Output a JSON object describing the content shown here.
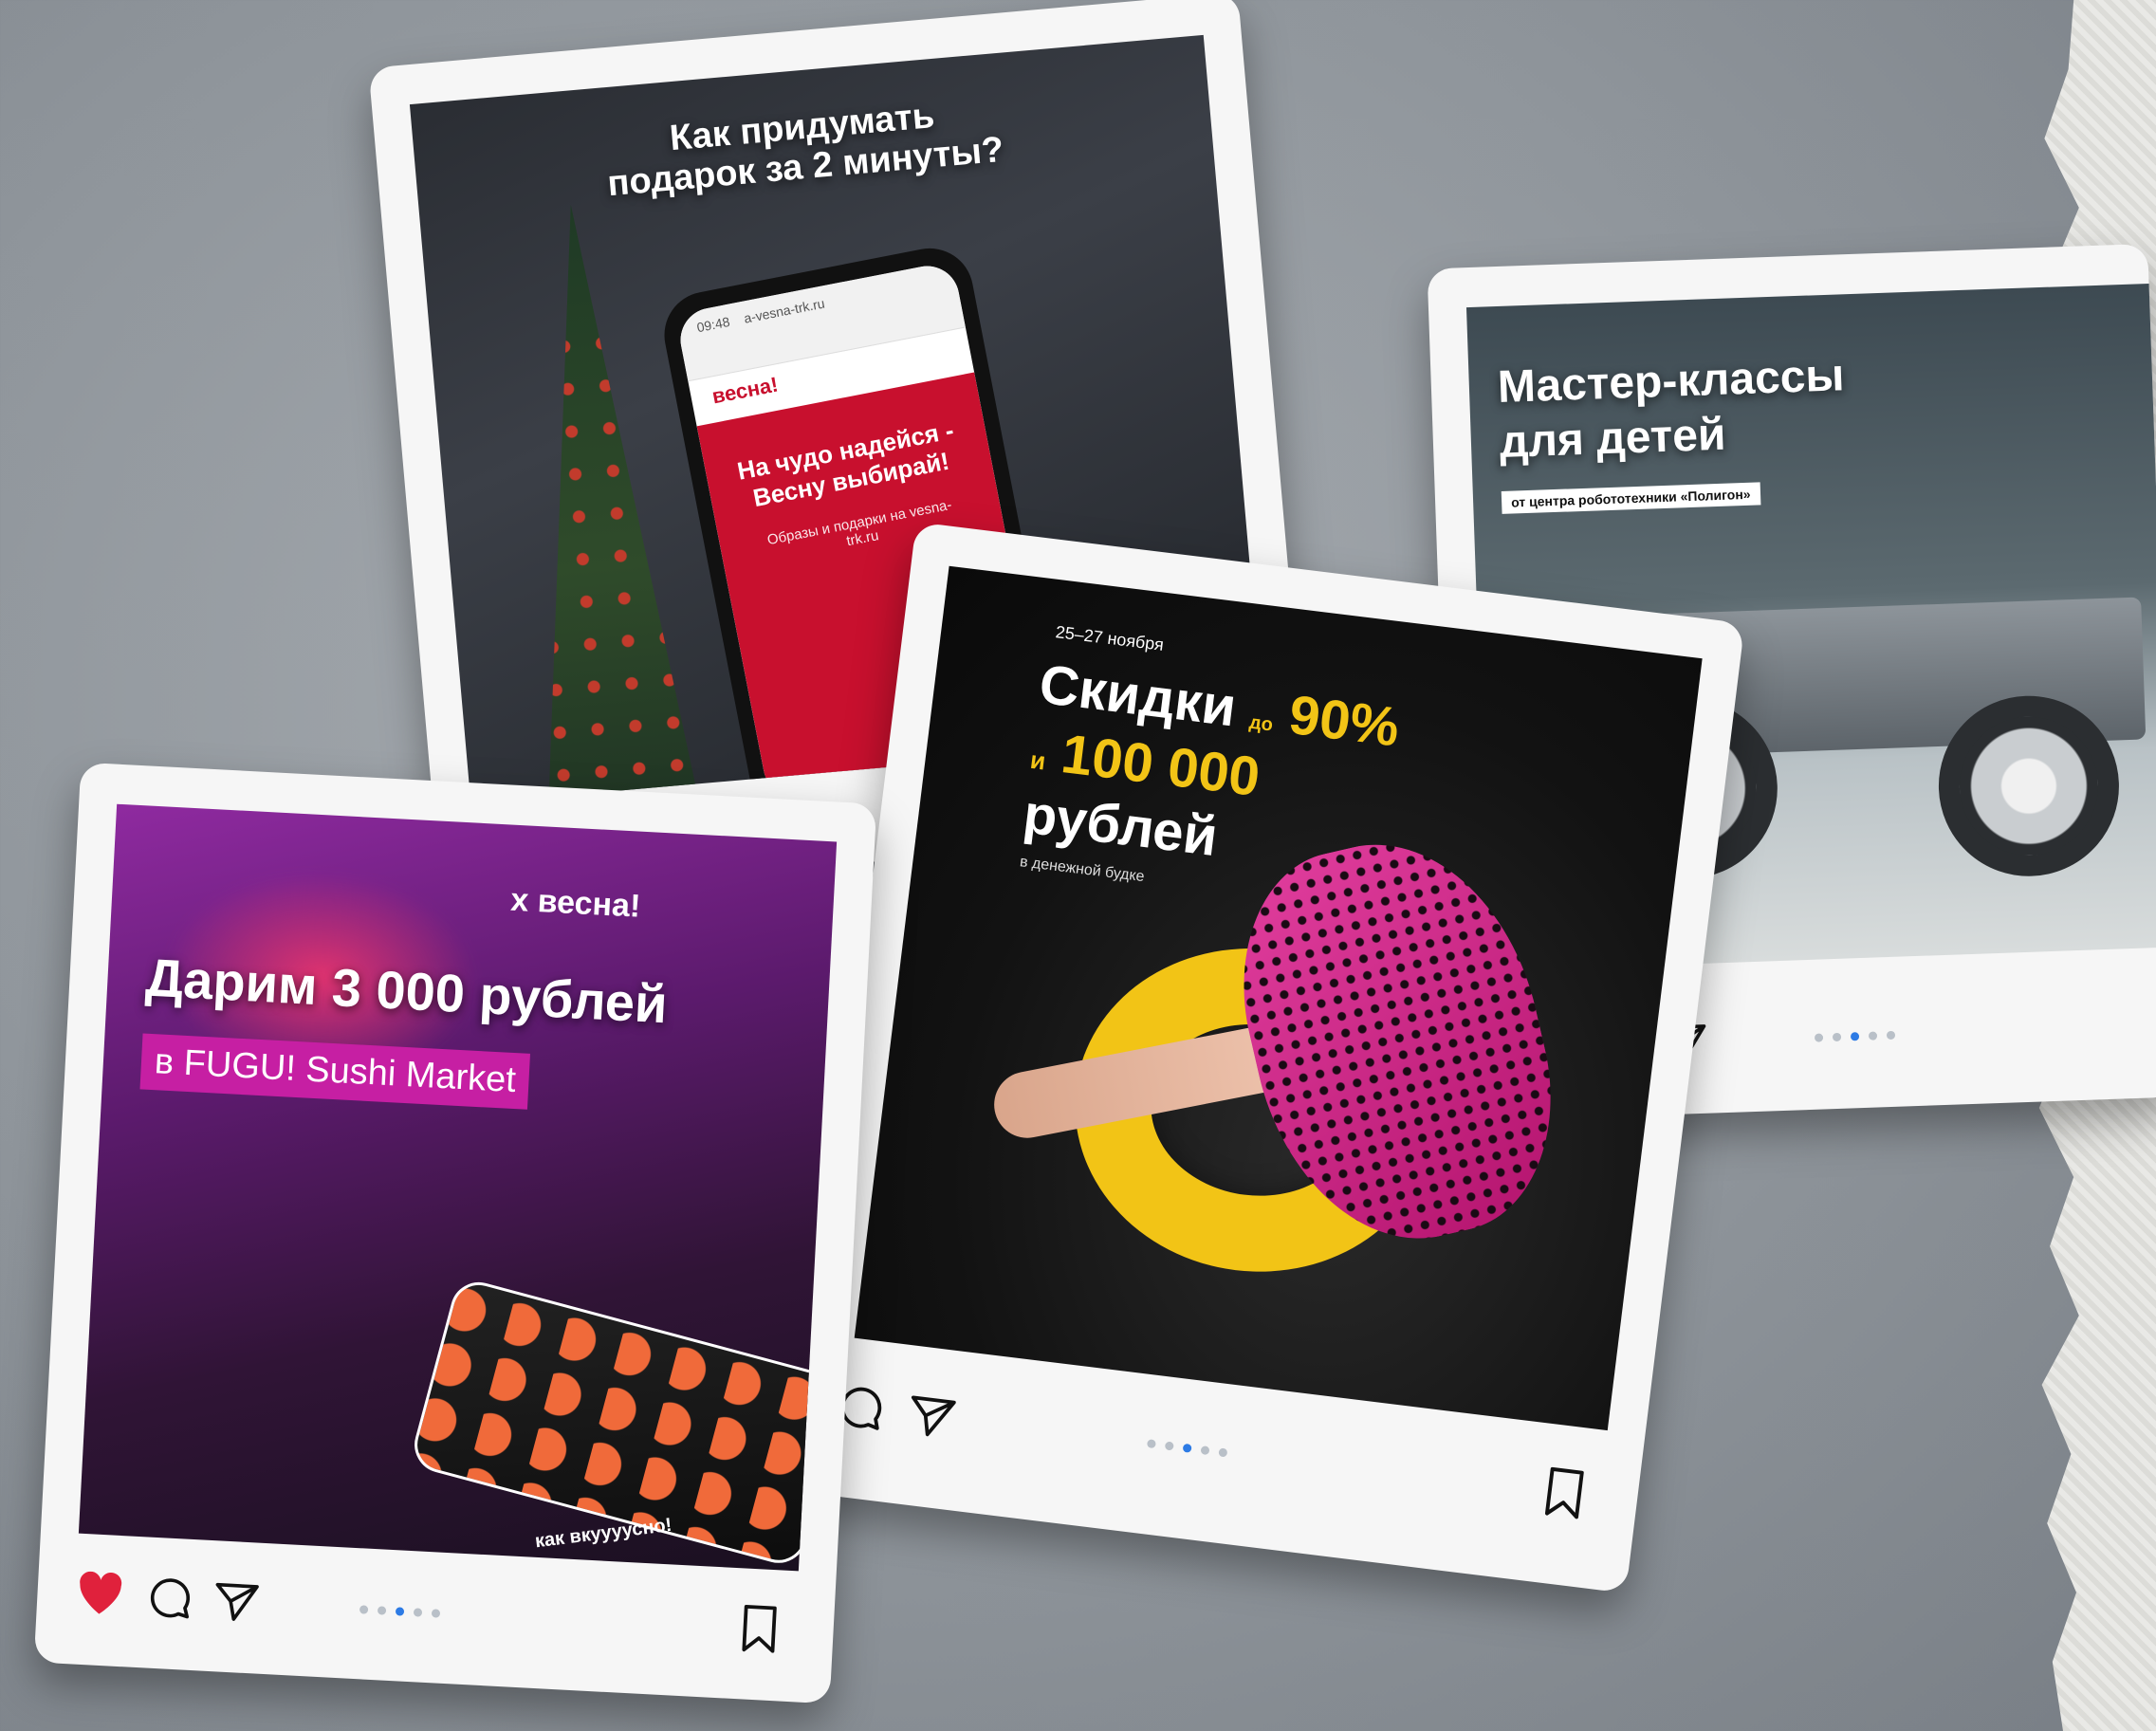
{
  "colors": {
    "accent_yellow": "#f2c416",
    "accent_magenta": "#c61fa3",
    "brand_red": "#c8102e",
    "like_red": "#e0213c",
    "dot_active": "#2d7be5"
  },
  "gift_post": {
    "headline": "Как придумать подарок за 2 минуты?",
    "phone_time": "09:48",
    "phone_url": "a-vesna-trk.ru",
    "phone_brand": "весна!",
    "phone_slogan": "На чудо надейся - Весну выбирай!",
    "phone_subtext": "Образы и подарки на vesna-trk.ru"
  },
  "robot_post": {
    "headline_line1": "Мастер-классы",
    "headline_line2": "для детей",
    "badge": "от центра робототехники «Полигон»",
    "icons": [
      "comment-icon",
      "send-icon"
    ],
    "carousel": {
      "count": 5,
      "active_index": 2
    }
  },
  "sushi_post": {
    "partner_mark": "x весна!",
    "headline": "Дарим 3 000 рублей",
    "badge": "в FUGU! Sushi Market",
    "caption": "как вкуууусно!",
    "icons": [
      "heart-icon",
      "comment-icon",
      "send-icon",
      "bookmark-icon"
    ],
    "carousel": {
      "count": 5,
      "active_index": 2
    }
  },
  "sale_post": {
    "date": "25–27 ноября",
    "line1": "Скидки",
    "prefix_up_to": "до",
    "percent": "90%",
    "and": "и",
    "amount": "100 000",
    "currency": "рублей",
    "subtext": "в денежной будке",
    "icons": [
      "comment-icon",
      "send-icon",
      "bookmark-icon"
    ],
    "carousel": {
      "count": 5,
      "active_index": 2
    }
  }
}
